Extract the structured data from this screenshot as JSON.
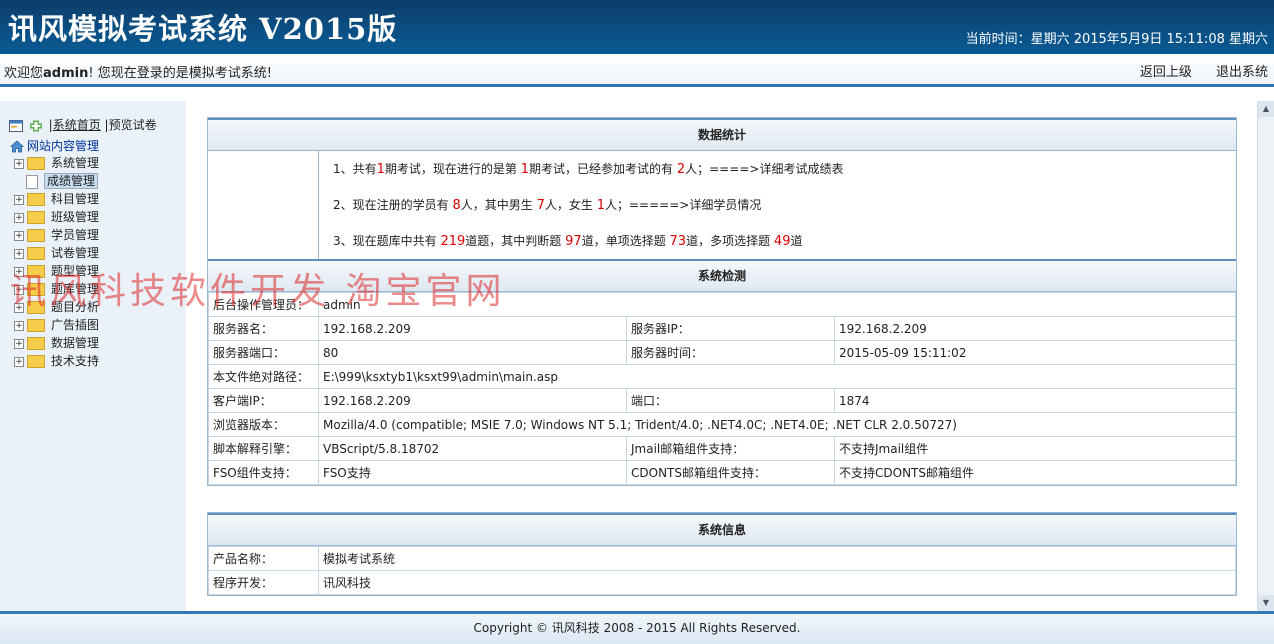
{
  "header": {
    "title": "讯风模拟考试系统  V2015版",
    "clock": "当前时间：星期六 2015年5月9日  15:11:08 星期六"
  },
  "welcome_bar": {
    "prefix": "欢迎您",
    "user": "admin",
    "suffix": "! 您现在登录的是模拟考试系统!",
    "back_label": "返回上级",
    "logout_label": "退出系统"
  },
  "sidebar": {
    "toolbar": {
      "home_label": "系统首页",
      "separator": "|",
      "preview_label": "预览试卷"
    },
    "root_label": "网站内容管理",
    "items": [
      {
        "label": "系统管理"
      },
      {
        "label": "成绩管理"
      },
      {
        "label": "科目管理"
      },
      {
        "label": "班级管理"
      },
      {
        "label": "学员管理"
      },
      {
        "label": "试卷管理"
      },
      {
        "label": "题型管理"
      },
      {
        "label": "题库管理"
      },
      {
        "label": "题目分析"
      },
      {
        "label": "广告插图"
      },
      {
        "label": "数据管理"
      },
      {
        "label": "技术支持"
      }
    ]
  },
  "watermark": "讯风科技软件开发 淘宝官网",
  "stats": {
    "title": "数据统计",
    "line1": {
      "a": "1、共有",
      "n1": "1",
      "b": "期考试，现在进行的是第",
      "n2": "1",
      "c": "期考试，已经参加考试的有",
      "n3": "2",
      "d": "人；====>详细考试成绩表"
    },
    "line2": {
      "a": "2、现在注册的学员有",
      "n1": "8",
      "b": "人，其中男生",
      "n2": "7",
      "c": "人，女生",
      "n3": "1",
      "d": "人；=====>详细学员情况"
    },
    "line3": {
      "a": "3、现在题库中共有",
      "n1": "219",
      "b": "道题，其中判断题",
      "n2": "97",
      "c": "道，单项选择题",
      "n3": "73",
      "d": "道，多项选择题",
      "n4": "49",
      "e": "道"
    }
  },
  "syscheck": {
    "title": "系统检测",
    "admin_label": "后台操作管理员：",
    "admin_value": "admin",
    "server_name_label": "服务器名：",
    "server_name_value": "192.168.2.209",
    "server_ip_label": "服务器IP：",
    "server_ip_value": "192.168.2.209",
    "server_port_label": "服务器端口：",
    "server_port_value": "80",
    "server_time_label": "服务器时间：",
    "server_time_value": "2015-05-09 15:11:02",
    "path_label": "本文件绝对路径：",
    "path_value": "E:\\999\\ksxtyb1\\ksxt99\\admin\\main.asp",
    "client_ip_label": "客户端IP：",
    "client_ip_value": "192.168.2.209",
    "port_label": "端口：",
    "port_value": "1874",
    "browser_label": "浏览器版本：",
    "browser_value": "Mozilla/4.0 (compatible; MSIE 7.0; Windows NT 5.1; Trident/4.0; .NET4.0C; .NET4.0E; .NET CLR 2.0.50727)",
    "script_label": "脚本解释引擎：",
    "script_value": "VBScript/5.8.18702",
    "jmail_label": "Jmail邮箱组件支持：",
    "jmail_value": "不支持Jmail组件",
    "fso_label": "FSO组件支持：",
    "fso_value": "FSO支持",
    "cdonts_label": "CDONTS邮箱组件支持：",
    "cdonts_value": "不支持CDONTS邮箱组件"
  },
  "sysinfo": {
    "title": "系统信息",
    "product_label": "产品名称：",
    "product_value": "模拟考试系统",
    "developer_label": "程序开发：",
    "developer_value": "讯风科技"
  },
  "footer": {
    "copyright": "Copyright © 讯风科技  2008 - 2015 All Rights Reserved."
  }
}
